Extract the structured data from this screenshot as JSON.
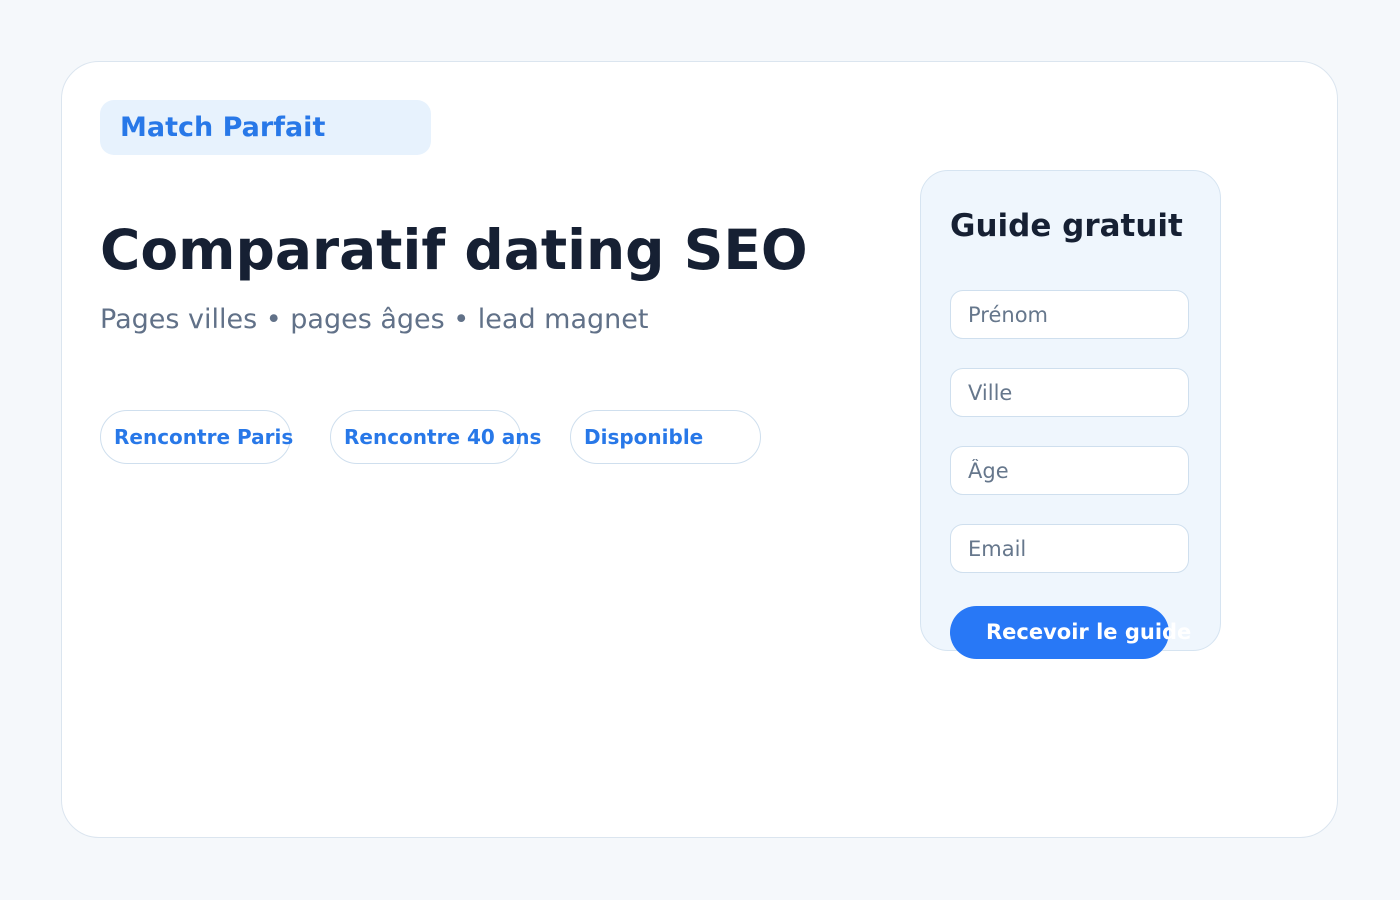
{
  "brand": {
    "name": "Match Parfait"
  },
  "hero": {
    "title": "Comparatif dating SEO",
    "subtitle": "Pages villes • pages âges • lead magnet"
  },
  "chips": [
    {
      "label": "Rencontre Paris"
    },
    {
      "label": "Rencontre 40 ans"
    },
    {
      "label": "Disponible"
    }
  ],
  "form": {
    "title": "Guide gratuit",
    "fields": [
      {
        "placeholder": "Prénom"
      },
      {
        "placeholder": "Ville"
      },
      {
        "placeholder": "Âge"
      },
      {
        "placeholder": "Email"
      }
    ],
    "submit_label": "Recevoir le guide"
  },
  "colors": {
    "accent": "#2878f6",
    "heading": "#162033",
    "muted": "#617188",
    "page_background": "#f5f8fb"
  }
}
